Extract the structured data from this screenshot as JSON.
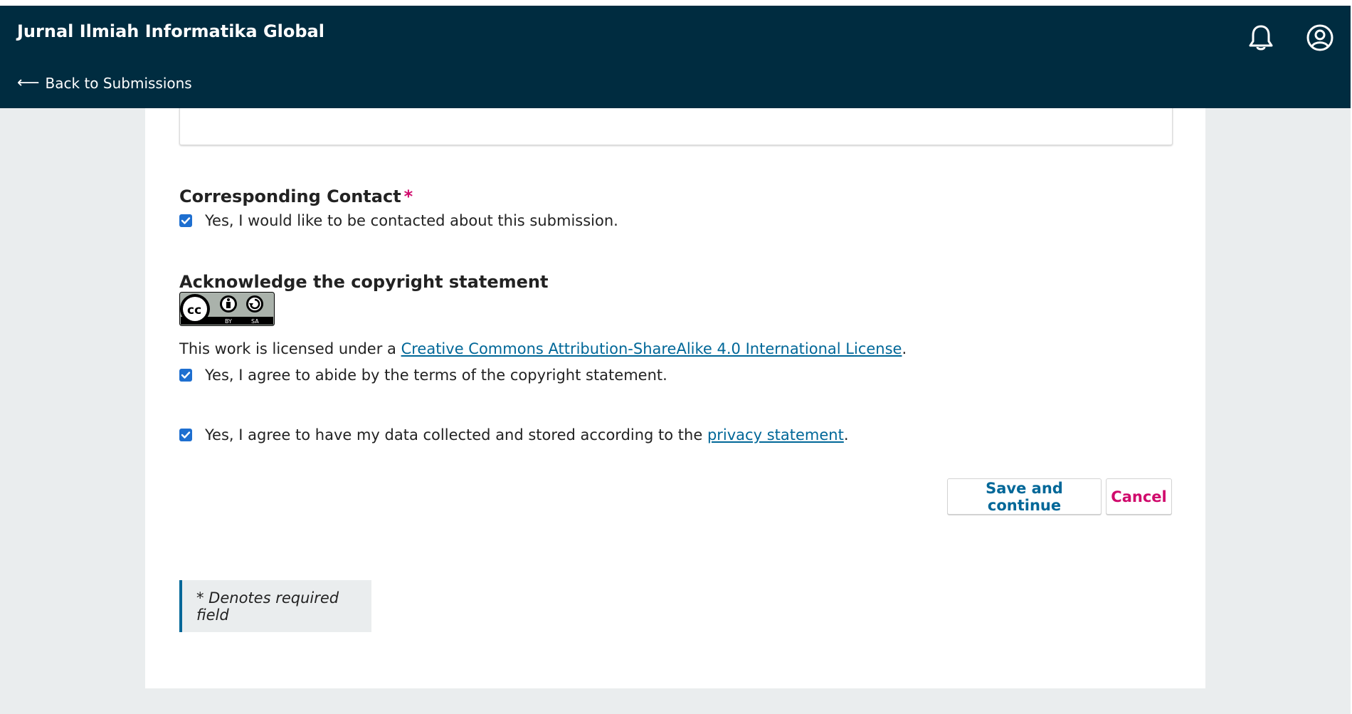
{
  "header": {
    "journal_title": "Jurnal Ilmiah Informatika Global",
    "back_link": "Back to Submissions",
    "back_arrow": "⟵",
    "bg_color": "#002c40",
    "icons": [
      "bell-icon",
      "user-circle-icon"
    ]
  },
  "form": {
    "corresponding_contact": {
      "title": "Corresponding Contact",
      "required_mark": "*",
      "checkbox_label": "Yes, I would like to be contacted about this submission.",
      "checked": true
    },
    "copyright": {
      "title": "Acknowledge the copyright statement",
      "badge_label": "BY SA",
      "license_prefix": "This work is licensed under a",
      "license_link": "Creative Commons Attribution-ShareAlike 4.0 International License",
      "license_suffix": ".",
      "checkbox_label": "Yes, I agree to abide by the terms of the copyright statement.",
      "checked": true
    },
    "privacy": {
      "checkbox_prefix": "Yes, I agree to have my data collected and stored according to the",
      "privacy_link": "privacy statement",
      "checkbox_suffix": ".",
      "checked": true
    },
    "buttons": {
      "save": "Save and continue",
      "cancel": "Cancel"
    },
    "required_note": "* Denotes required field"
  },
  "colors": {
    "link": "#006798",
    "required": "#d00a6c",
    "checkbox": "#1e6fd0",
    "page_bg": "#eaedee"
  }
}
